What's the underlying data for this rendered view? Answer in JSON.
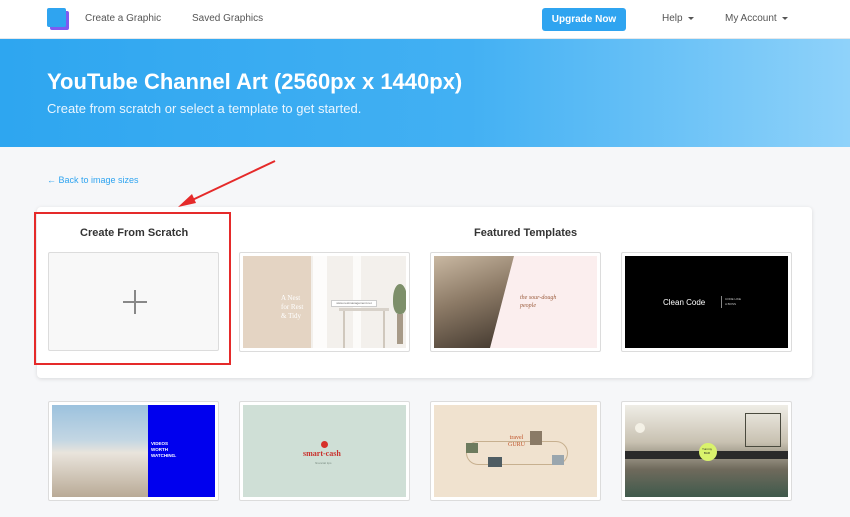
{
  "nav": {
    "create": "Create a Graphic",
    "saved": "Saved Graphics",
    "upgrade": "Upgrade Now",
    "help": "Help",
    "account": "My Account"
  },
  "hero": {
    "title": "YouTube Channel Art (2560px x 1440px)",
    "subtitle": "Create from scratch or select a template to get started."
  },
  "back_link": "← Back to image sizes",
  "scratch": {
    "title": "Create From Scratch"
  },
  "featured": {
    "title": "Featured Templates"
  },
  "templates": {
    "t1": {
      "line1": "A Nest",
      "line2": "for Rest",
      "line3": "& Tidy",
      "tag": "www.nestmanagement.net"
    },
    "t2": {
      "line1": "the sour-dough",
      "line2": "people"
    },
    "t3": {
      "title": "Clean Code",
      "tag1": "CODE LIKE",
      "tag2": "A BOSS"
    },
    "t4": {
      "line1": "VIDEOS",
      "line2": "WORTH",
      "line3": "WATCHING."
    },
    "t5": {
      "title": "smart-cash",
      "sub": "financial tips"
    },
    "t6": {
      "line1": "travel",
      "line2": "GURU"
    },
    "t7": {
      "badge1": "Yummy",
      "badge2": "BAR"
    }
  },
  "colors": {
    "accent": "#2fa4f0",
    "highlight": "#e52a2a"
  }
}
